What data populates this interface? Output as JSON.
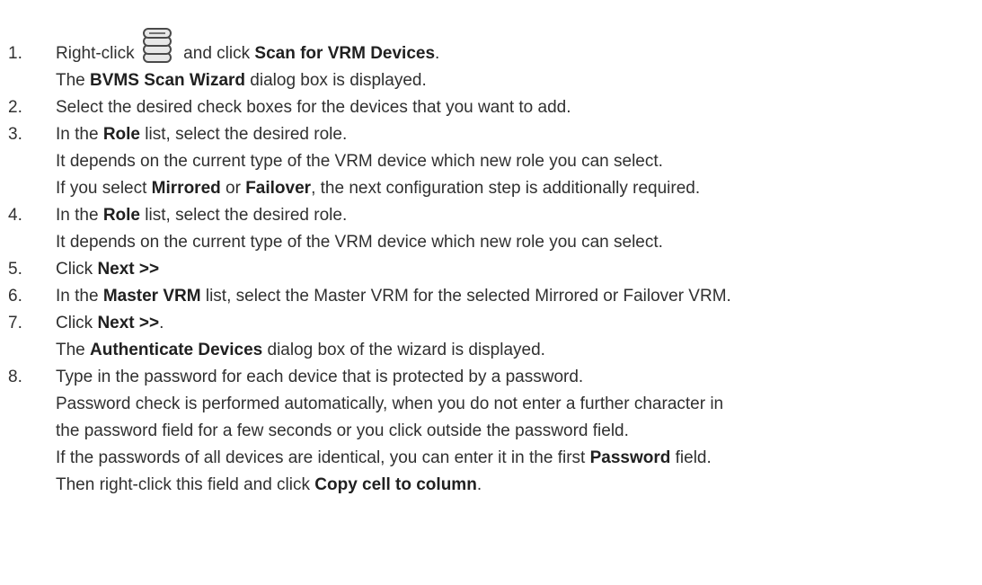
{
  "steps": [
    {
      "number": "1.",
      "line1": {
        "before": "Right-click ",
        "after": " and click ",
        "bold": "Scan for VRM Devices",
        "end": "."
      },
      "line2": {
        "before": "The ",
        "bold": "BVMS Scan Wizard",
        "after": " dialog box is displayed."
      }
    },
    {
      "number": "2.",
      "text": "Select the desired check boxes for the devices that you want to add."
    },
    {
      "number": "3.",
      "line1": {
        "before": "In the ",
        "bold": "Role",
        "after": " list, select the desired role."
      },
      "line2": "It depends on the current type of the VRM device which new role you can select.",
      "line3": {
        "before": "If you select ",
        "bold1": "Mirrored",
        "mid": " or ",
        "bold2": "Failover",
        "after": ", the next configuration step is additionally required."
      }
    },
    {
      "number": "4.",
      "line1": {
        "before": "In the ",
        "bold": "Role",
        "after": " list, select the desired role."
      },
      "line2": "It depends on the current type of the VRM device which new role you can select."
    },
    {
      "number": "5.",
      "line1": {
        "before": "Click ",
        "bold": "Next >>"
      }
    },
    {
      "number": "6.",
      "line1": {
        "before": "In the ",
        "bold": "Master VRM",
        "after": " list, select the Master VRM for the selected Mirrored or Failover VRM."
      }
    },
    {
      "number": "7.",
      "line1": {
        "before": "Click ",
        "bold": "Next >>",
        "after": "."
      },
      "line2": {
        "before": "The ",
        "bold": "Authenticate Devices",
        "after": " dialog box of the wizard is displayed."
      }
    },
    {
      "number": "8.",
      "line1": "Type in the password for each device that is protected by a password.",
      "line2": "Password check is performed automatically, when you do not enter a further character in",
      "line3": "the password field for a few seconds or you click outside the password field.",
      "line4": {
        "before": "If the passwords of all devices are identical, you can enter it in the first ",
        "bold": "Password",
        "after": " field."
      },
      "line5": {
        "before": "Then right-click this field and click ",
        "bold": "Copy cell to column",
        "after": "."
      }
    }
  ],
  "icon": "database-icon"
}
